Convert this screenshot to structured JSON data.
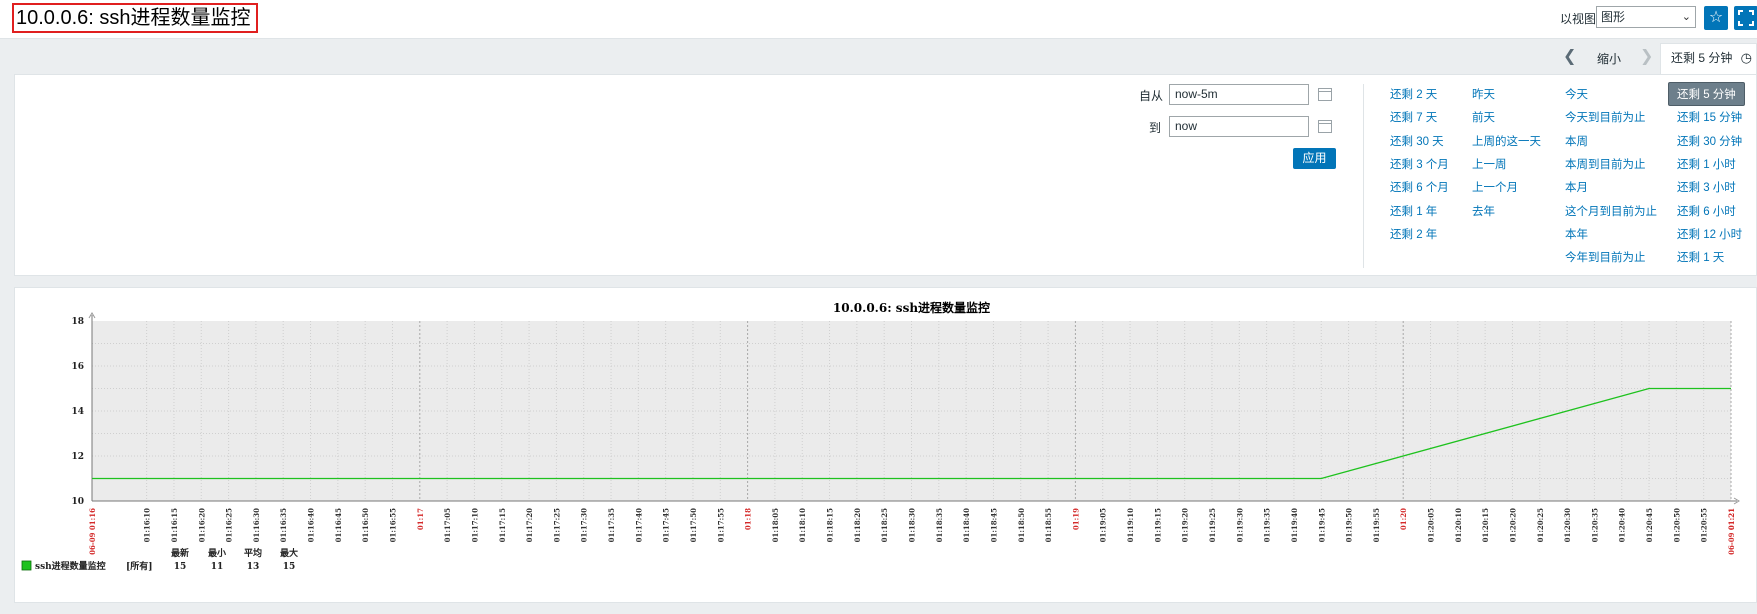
{
  "header": {
    "title": "10.0.0.6: ssh进程数量监控",
    "view_label": "以视图",
    "view_select": "图形"
  },
  "nav": {
    "zoom_out": "缩小",
    "range_tab": "还剩 5 分钟"
  },
  "filter": {
    "from_label": "自从",
    "from_value": "now-5m",
    "to_label": "到",
    "to_value": "now",
    "apply": "应用"
  },
  "quick_ranges": {
    "col1": [
      "还剩 2 天",
      "还剩 7 天",
      "还剩 30 天",
      "还剩 3 个月",
      "还剩 6 个月",
      "还剩 1 年",
      "还剩 2 年"
    ],
    "col2": [
      "昨天",
      "前天",
      "上周的这一天",
      "上一周",
      "上一个月",
      "去年"
    ],
    "col3": [
      "今天",
      "今天到目前为止",
      "本周",
      "本周到目前为止",
      "本月",
      "这个月到目前为止",
      "本年",
      "今年到目前为止"
    ],
    "col4": [
      "还剩 5 分钟",
      "还剩 15 分钟",
      "还剩 30 分钟",
      "还剩 1 小时",
      "还剩 3 小时",
      "还剩 6 小时",
      "还剩 12 小时",
      "还剩 1 天"
    ]
  },
  "chart_data": {
    "type": "line",
    "title": "10.0.0.6: ssh进程数量监控",
    "ylim": [
      10,
      18
    ],
    "y_ticks": [
      10,
      12,
      14,
      16,
      18
    ],
    "x_start_label": "06-09 01:16",
    "x_end_label": "06-09 01:21",
    "x_tick_labels": [
      "01:16:10",
      "01:16:15",
      "01:16:20",
      "01:16:25",
      "01:16:30",
      "01:16:35",
      "01:16:40",
      "01:16:45",
      "01:16:50",
      "01:16:55",
      "01:17",
      "01:17:05",
      "01:17:10",
      "01:17:15",
      "01:17:20",
      "01:17:25",
      "01:17:30",
      "01:17:35",
      "01:17:40",
      "01:17:45",
      "01:17:50",
      "01:17:55",
      "01:18",
      "01:18:05",
      "01:18:10",
      "01:18:15",
      "01:18:20",
      "01:18:25",
      "01:18:30",
      "01:18:35",
      "01:18:40",
      "01:18:45",
      "01:18:50",
      "01:18:55",
      "01:19",
      "01:19:05",
      "01:19:10",
      "01:19:15",
      "01:19:20",
      "01:19:25",
      "01:19:30",
      "01:19:35",
      "01:19:40",
      "01:19:45",
      "01:19:50",
      "01:19:55",
      "01:20",
      "01:20:05",
      "01:20:10",
      "01:20:15",
      "01:20:20",
      "01:20:25",
      "01:20:30",
      "01:20:35",
      "01:20:40",
      "01:20:45",
      "01:20:50",
      "01:20:55",
      "01:21"
    ],
    "major_ticks": [
      "01:17",
      "01:18",
      "01:19",
      "01:20",
      "01:21"
    ],
    "grid": true,
    "series": [
      {
        "name": "ssh进程数量监控",
        "color": "#1ec21e",
        "points": [
          {
            "x": "01:16:00",
            "y": 11
          },
          {
            "x": "01:19:45",
            "y": 11
          },
          {
            "x": "01:20:45",
            "y": 15
          },
          {
            "x": "01:21:00",
            "y": 15
          }
        ]
      }
    ],
    "legend": {
      "headers": [
        "最新",
        "最小",
        "平均",
        "最大"
      ],
      "rows": [
        {
          "name": "ssh进程数量监控",
          "func": "[所有]",
          "values": [
            "15",
            "11",
            "13",
            "15"
          ]
        }
      ]
    }
  }
}
